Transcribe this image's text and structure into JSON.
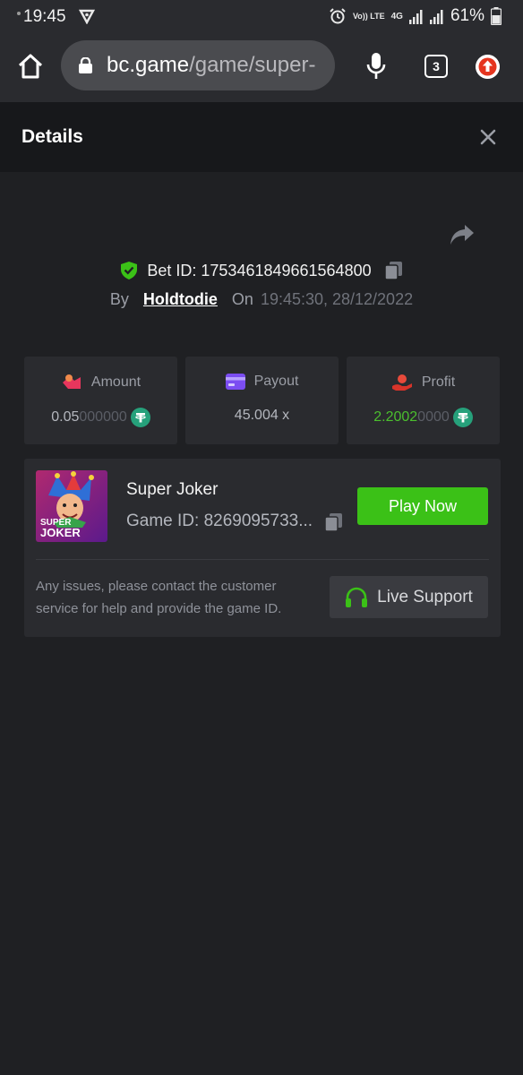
{
  "status_bar": {
    "time": "19:45",
    "network_label": "Vo)) LTE",
    "network_type": "4G",
    "battery": "61%"
  },
  "browser": {
    "url_domain": "bc.game",
    "url_path": "/game/super-",
    "tab_count": "3"
  },
  "header": {
    "title": "Details"
  },
  "bet": {
    "id_label": "Bet ID: 1753461849661564800",
    "by_label": "By",
    "username": "Holdtodie",
    "on_label": "On",
    "datetime": "19:45:30, 28/12/2022"
  },
  "stats": {
    "amount": {
      "label": "Amount",
      "value_bright": "0.05",
      "value_dim": "000000"
    },
    "payout": {
      "label": "Payout",
      "value": "45.004 x"
    },
    "profit": {
      "label": "Profit",
      "value_bright": "2.2002",
      "value_dim": "0000"
    }
  },
  "game": {
    "name": "Super Joker",
    "id_text": "Game ID: 8269095733...",
    "thumb_text_1": "SUPER",
    "thumb_text_2": "JOKER",
    "play_label": "Play Now",
    "help_text": "Any issues, please contact the customer service for help and provide the game ID.",
    "support_label": "Live Support"
  },
  "colors": {
    "accent_green": "#3bc117",
    "profit_green": "#4bbf2e",
    "background": "#1f2023",
    "card": "#2a2b2f"
  },
  "icons": [
    "vpn-icon",
    "alarm-icon",
    "signal-icon",
    "battery-icon",
    "home-icon",
    "lock-icon",
    "mic-icon",
    "tabs-icon",
    "update-icon",
    "close-icon",
    "share-icon",
    "shield-check-icon",
    "copy-icon",
    "amount-icon",
    "payout-icon",
    "profit-icon",
    "tether-icon",
    "headset-icon"
  ]
}
